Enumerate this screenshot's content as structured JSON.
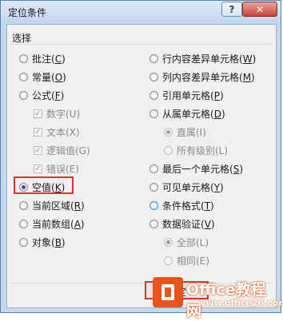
{
  "window": {
    "title": "定位条件",
    "help_glyph": "?",
    "close_glyph": "✕"
  },
  "group": {
    "label": "选择"
  },
  "options": {
    "comments": {
      "label": "批注(",
      "key": "C",
      "suffix": ")"
    },
    "constants": {
      "label": "常量(",
      "key": "O",
      "suffix": ")"
    },
    "formulas": {
      "label": "公式(",
      "key": "F",
      "suffix": ")"
    },
    "f_numbers": {
      "label": "数字(U)"
    },
    "f_text": {
      "label": "文本(X)"
    },
    "f_logical": {
      "label": "逻辑值(G)"
    },
    "f_errors": {
      "label": "错误(E)"
    },
    "blanks": {
      "label": "空值(",
      "key": "K",
      "suffix": ")"
    },
    "current_region": {
      "label": "当前区域(",
      "key": "R",
      "suffix": ")"
    },
    "current_array": {
      "label": "当前数组(",
      "key": "A",
      "suffix": ")"
    },
    "objects": {
      "label": "对象(",
      "key": "B",
      "suffix": ")"
    },
    "row_diff": {
      "label": "行内容差异单元格(",
      "key": "W",
      "suffix": ")"
    },
    "col_diff": {
      "label": "列内容差异单元格(",
      "key": "M",
      "suffix": ")"
    },
    "precedents": {
      "label": "引用单元格(",
      "key": "P",
      "suffix": ")"
    },
    "dependents": {
      "label": "从属单元格(",
      "key": "D",
      "suffix": ")"
    },
    "d_direct": {
      "label": "直属(I)"
    },
    "d_all": {
      "label": "所有级别(L)"
    },
    "last_cell": {
      "label": "最后一个单元格(",
      "key": "S",
      "suffix": ")"
    },
    "visible_cells": {
      "label": "可见单元格(",
      "key": "Y",
      "suffix": ")"
    },
    "conditional_formats": {
      "label": "条件格式(",
      "key": "T",
      "suffix": ")"
    },
    "data_validation": {
      "label": "数据验证(",
      "key": "V",
      "suffix": ")"
    },
    "v_all": {
      "label": "全部(L)"
    },
    "v_same": {
      "label": "相同(E)"
    }
  },
  "selected_option": "空值(K)",
  "buttons": {
    "ok_label": "确定"
  },
  "watermark": {
    "title": "Office教程网",
    "url": "www.office26.com"
  },
  "colors": {
    "highlight": "#e0322d",
    "title_bar": "#c2d6ee",
    "watermark_orange": "#e8541e"
  }
}
